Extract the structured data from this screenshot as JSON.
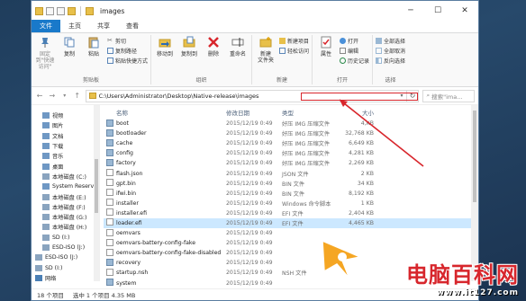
{
  "window": {
    "title": "images",
    "controls": [
      "─",
      "☐",
      "✕"
    ]
  },
  "ribbon_tabs": [
    "文件",
    "主页",
    "共享",
    "查看"
  ],
  "ribbon": {
    "clipboard": {
      "label": "剪贴板",
      "pin": "固定到\"快速访问\"",
      "copy": "复制",
      "paste": "粘贴",
      "cut": "剪切",
      "copy_path": "复制路径",
      "paste_shortcut": "粘贴快捷方式"
    },
    "organize": {
      "label": "组织",
      "move_to": "移动到",
      "copy_to": "复制到",
      "delete": "删除",
      "rename": "重命名"
    },
    "new": {
      "label": "新建",
      "new_folder": "新建\n文件夹",
      "new_item": "新建项目",
      "easy_access": "轻松访问"
    },
    "open": {
      "label": "打开",
      "properties": "属性",
      "open": "打开",
      "edit": "编辑",
      "history": "历史记录"
    },
    "select": {
      "label": "选择",
      "select_all": "全部选择",
      "select_none": "全部取消",
      "invert": "反向选择"
    }
  },
  "address": {
    "path": "C:\\Users\\Administrator\\Desktop\\Native-release\\images",
    "search_placeholder": "搜索\"ima..."
  },
  "columns": {
    "name": "名称",
    "date": "修改日期",
    "type": "类型",
    "size": "大小"
  },
  "nav_items": [
    {
      "label": "视频",
      "level": 1
    },
    {
      "label": "图片",
      "level": 1
    },
    {
      "label": "文档",
      "level": 1
    },
    {
      "label": "下载",
      "level": 1
    },
    {
      "label": "音乐",
      "level": 1
    },
    {
      "label": "桌面",
      "level": 1
    },
    {
      "label": "本地磁盘 (C:)",
      "level": 1
    },
    {
      "label": "System Reserve",
      "level": 1
    },
    {
      "label": "本地磁盘 (E:)",
      "level": 1
    },
    {
      "label": "本地磁盘 (F:)",
      "level": 1
    },
    {
      "label": "本地磁盘 (G:)",
      "level": 1
    },
    {
      "label": "本地磁盘 (H:)",
      "level": 1
    },
    {
      "label": "SD (I:)",
      "level": 1
    },
    {
      "label": "ESD-ISO (J:)",
      "level": 1
    },
    {
      "label": "ESD-ISO (J:)",
      "level": 0
    },
    {
      "label": "SD (I:)",
      "level": 0
    },
    {
      "label": "网络",
      "level": 0
    }
  ],
  "files": [
    {
      "name": "boot",
      "date": "2015/12/19 0:49",
      "type": "好压 IMG 压缩文件",
      "size": "4,KB",
      "icon": "img"
    },
    {
      "name": "bootloader",
      "date": "2015/12/19 0:49",
      "type": "好压 IMG 压缩文件",
      "size": "32,768 KB",
      "icon": "img"
    },
    {
      "name": "cache",
      "date": "2015/12/19 0:49",
      "type": "好压 IMG 压缩文件",
      "size": "6,649 KB",
      "icon": "img"
    },
    {
      "name": "config",
      "date": "2015/12/19 0:49",
      "type": "好压 IMG 压缩文件",
      "size": "4,281 KB",
      "icon": "img"
    },
    {
      "name": "factory",
      "date": "2015/12/19 0:49",
      "type": "好压 IMG 压缩文件",
      "size": "2,269 KB",
      "icon": "img"
    },
    {
      "name": "flash.json",
      "date": "2015/12/19 0:49",
      "type": "JSON 文件",
      "size": "2 KB",
      "icon": "file"
    },
    {
      "name": "gpt.bin",
      "date": "2015/12/19 0:49",
      "type": "BIN 文件",
      "size": "34 KB",
      "icon": "file"
    },
    {
      "name": "ifwi.bin",
      "date": "2015/12/19 0:49",
      "type": "BIN 文件",
      "size": "8,192 KB",
      "icon": "file"
    },
    {
      "name": "installer",
      "date": "2015/12/19 0:49",
      "type": "Windows 命令脚本",
      "size": "1 KB",
      "icon": "file"
    },
    {
      "name": "installer.efi",
      "date": "2015/12/19 0:49",
      "type": "EFI 文件",
      "size": "2,404 KB",
      "icon": "file"
    },
    {
      "name": "loader.efi",
      "date": "2015/12/19 0:49",
      "type": "EFI 文件",
      "size": "4,465 KB",
      "icon": "file",
      "selected": true
    },
    {
      "name": "oemvars",
      "date": "2015/12/19 0:49",
      "type": "",
      "size": "",
      "icon": "file"
    },
    {
      "name": "oemvars-battery-config-fake",
      "date": "2015/12/19 0:49",
      "type": "",
      "size": "",
      "icon": "file"
    },
    {
      "name": "oemvars-battery-config-fake-disabled",
      "date": "2015/12/19 0:49",
      "type": "",
      "size": "",
      "icon": "file"
    },
    {
      "name": "recovery",
      "date": "2015/12/19 0:49",
      "type": "",
      "size": "",
      "icon": "img"
    },
    {
      "name": "startup.nsh",
      "date": "2015/12/19 0:49",
      "type": "NSH 文件",
      "size": "",
      "icon": "file"
    },
    {
      "name": "system",
      "date": "2015/12/19 0:49",
      "type": "",
      "size": "",
      "icon": "img"
    }
  ],
  "status": {
    "count": "18 个项目",
    "selection": "选中 1 个项目 4.35 MB"
  },
  "watermark": {
    "brand": "电脑百科网",
    "url": "www.it127.com"
  },
  "colors": {
    "accent": "#1979ca",
    "highlight": "#d8262c",
    "selection": "#cce8ff"
  }
}
